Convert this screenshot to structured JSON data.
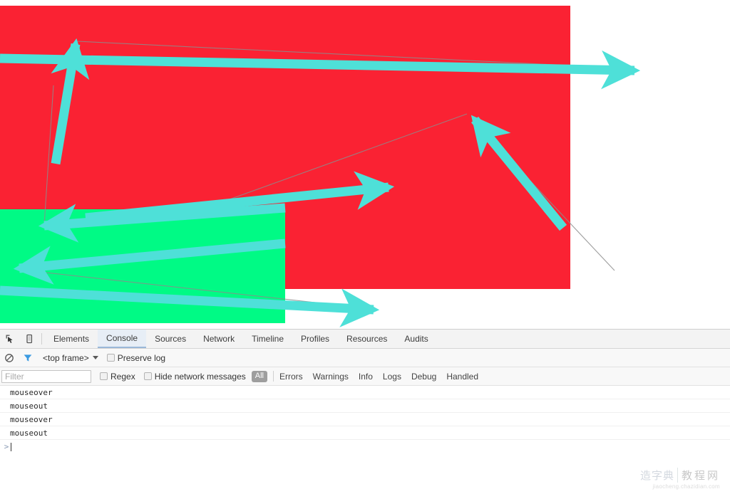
{
  "page": {
    "red_box": {
      "color": "#fa2233",
      "name": "red-outer-box"
    },
    "green_box": {
      "color": "#00fa85",
      "name": "green-inner-box"
    },
    "annotation_color": "#4ee0d8",
    "hairline_color": "#8a8a8a"
  },
  "devtools": {
    "icons": {
      "inspect": "inspect-element-icon",
      "device": "device-toolbar-icon",
      "clear": "clear-console-icon",
      "filter": "filter-funnel-icon"
    },
    "tabs": [
      {
        "label": "Elements",
        "active": false
      },
      {
        "label": "Console",
        "active": true
      },
      {
        "label": "Sources",
        "active": false
      },
      {
        "label": "Network",
        "active": false
      },
      {
        "label": "Timeline",
        "active": false
      },
      {
        "label": "Profiles",
        "active": false
      },
      {
        "label": "Resources",
        "active": false
      },
      {
        "label": "Audits",
        "active": false
      }
    ],
    "frame_row": {
      "frame_selected": "<top frame>",
      "preserve_log_label": "Preserve log",
      "preserve_log_checked": false
    },
    "filter_row": {
      "filter_placeholder": "Filter",
      "filter_value": "",
      "regex_label": "Regex",
      "regex_checked": false,
      "hide_network_label": "Hide network messages",
      "hide_network_checked": false,
      "all_pill": "All",
      "levels": [
        "Errors",
        "Warnings",
        "Info",
        "Logs",
        "Debug",
        "Handled"
      ]
    },
    "console_messages": [
      "mouseover",
      "mouseout",
      "mouseover",
      "mouseout"
    ],
    "prompt_symbol": ">"
  },
  "watermark": {
    "brand_cn": "造字典",
    "brand_box": "教程网",
    "url": "jiaocheng.chazidian.com"
  }
}
